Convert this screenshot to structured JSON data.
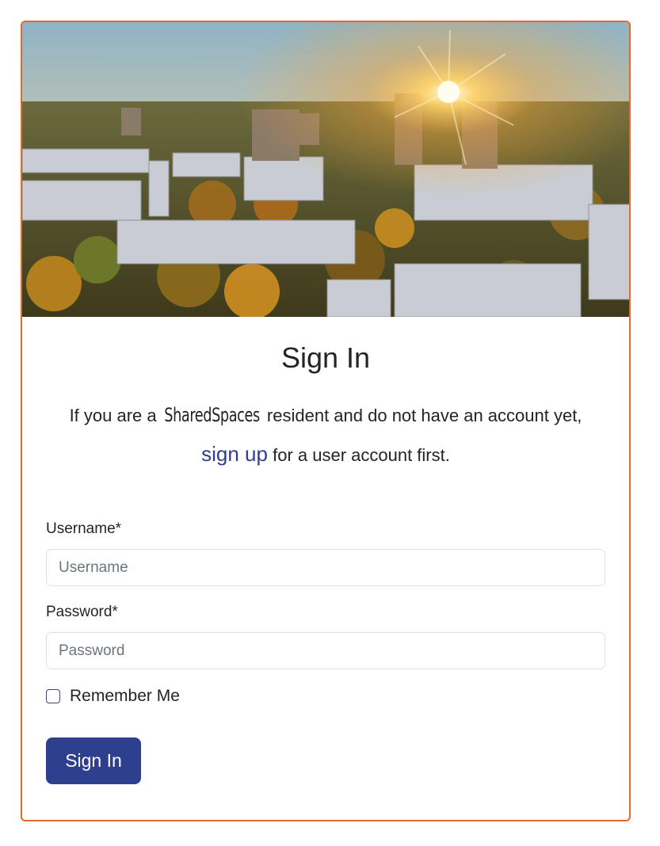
{
  "page": {
    "title": "Sign In",
    "intro_before": "If you are a ",
    "brand_name": "SharedSpaces",
    "intro_middle": " resident and do not have an account yet, ",
    "signup_link": "sign up",
    "intro_after": " for a user account first."
  },
  "form": {
    "username_label": "Username*",
    "username_placeholder": "Username",
    "username_value": "",
    "password_label": "Password*",
    "password_placeholder": "Password",
    "password_value": "",
    "remember_label": "Remember Me",
    "remember_checked": false,
    "submit_label": "Sign In"
  },
  "colors": {
    "accent_border": "#e8682b",
    "primary": "#2e3f8f",
    "link": "#2e3f8f"
  },
  "hero_image": {
    "subject": "aerial city sunrise"
  }
}
